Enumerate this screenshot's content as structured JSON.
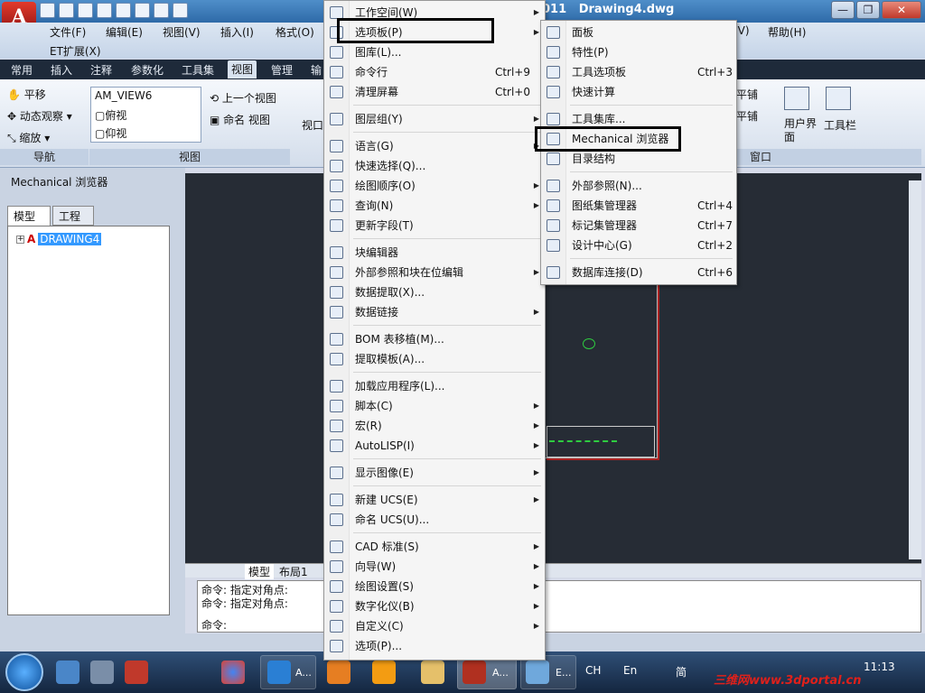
{
  "window": {
    "title": "Drawing4.dwg",
    "title_prefix": "011",
    "buttons": [
      "—",
      "❐",
      "✕"
    ]
  },
  "menubar": {
    "items": [
      "文件(F)",
      "编辑(E)",
      "视图(V)",
      "插入(I)",
      "格式(O)",
      "(V)",
      "帮助(H)"
    ],
    "row2": "ET扩展(X)"
  },
  "ribbon_tabs": [
    "常用",
    "插入",
    "注释",
    "参数化",
    "工具集",
    "视图",
    "管理",
    "输"
  ],
  "ribbon_tab_active": "视图",
  "ribbon": {
    "nav": [
      "平移",
      "动态观察",
      "缩放"
    ],
    "nav_group": "导航",
    "views": [
      "AM_VIEW6",
      "俯视",
      "仰视"
    ],
    "view_buttons": [
      "上一个视图",
      "命名 视图"
    ],
    "view_group": "视图",
    "viewport_label": "视口",
    "right_items": [
      "平铺",
      "平铺",
      "用户界面",
      "工具栏"
    ],
    "window_group": "窗口"
  },
  "palette": {
    "title": "Mechanical 浏览器",
    "tabs": [
      "模型",
      "工程图"
    ],
    "tree_item": "DRAWING4"
  },
  "layout_tabs": [
    "模型",
    "布局1"
  ],
  "command_lines": [
    "命令: 指定对角点:",
    "命令: 指定对角点:",
    "命令:"
  ],
  "clock": "11:13",
  "tray": {
    "lang": "CH",
    "input": "En",
    "ime": "简"
  },
  "taskbar": [
    {
      "label": "A..."
    },
    {
      "label": "A..."
    },
    {
      "label": "E..."
    }
  ],
  "watermark": "三维网www.3dportal.cn",
  "tools_menu": {
    "items": [
      {
        "label": "工作空间(W)",
        "arrow": true
      },
      {
        "label": "选项板(P)",
        "arrow": true
      },
      {
        "label": "图库(L)..."
      },
      {
        "label": "命令行",
        "shortcut": "Ctrl+9"
      },
      {
        "label": "清理屏幕",
        "shortcut": "Ctrl+0"
      },
      {
        "label": "图层组(Y)",
        "arrow": true
      },
      {
        "label": "语言(G)",
        "arrow": true
      },
      {
        "label": "快速选择(Q)..."
      },
      {
        "label": "绘图顺序(O)",
        "arrow": true
      },
      {
        "label": "查询(N)",
        "arrow": true
      },
      {
        "label": "更新字段(T)"
      },
      {
        "label": "块编辑器"
      },
      {
        "label": "外部参照和块在位编辑",
        "arrow": true
      },
      {
        "label": "数据提取(X)..."
      },
      {
        "label": "数据链接",
        "arrow": true
      },
      {
        "label": "BOM 表移植(M)..."
      },
      {
        "label": "提取模板(A)..."
      },
      {
        "label": "加载应用程序(L)..."
      },
      {
        "label": "脚本(C)",
        "arrow": true
      },
      {
        "label": "宏(R)",
        "arrow": true
      },
      {
        "label": "AutoLISP(I)",
        "arrow": true
      },
      {
        "label": "显示图像(E)",
        "arrow": true
      },
      {
        "label": "新建 UCS(E)",
        "arrow": true
      },
      {
        "label": "命名 UCS(U)..."
      },
      {
        "label": "CAD 标准(S)",
        "arrow": true
      },
      {
        "label": "向导(W)",
        "arrow": true
      },
      {
        "label": "绘图设置(S)",
        "arrow": true
      },
      {
        "label": "数字化仪(B)",
        "arrow": true
      },
      {
        "label": "自定义(C)",
        "arrow": true
      },
      {
        "label": "选项(P)..."
      }
    ]
  },
  "palettes_submenu": {
    "items": [
      {
        "label": "面板"
      },
      {
        "label": "特性(P)"
      },
      {
        "label": "工具选项板",
        "shortcut": "Ctrl+3"
      },
      {
        "label": "快速计算"
      },
      {
        "label": "工具集库..."
      },
      {
        "label": "Mechanical 浏览器"
      },
      {
        "label": "目录结构"
      },
      {
        "label": "外部参照(N)..."
      },
      {
        "label": "图纸集管理器",
        "shortcut": "Ctrl+4"
      },
      {
        "label": "标记集管理器",
        "shortcut": "Ctrl+7"
      },
      {
        "label": "设计中心(G)",
        "shortcut": "Ctrl+2"
      },
      {
        "label": "数据库连接(D)",
        "shortcut": "Ctrl+6"
      }
    ]
  }
}
